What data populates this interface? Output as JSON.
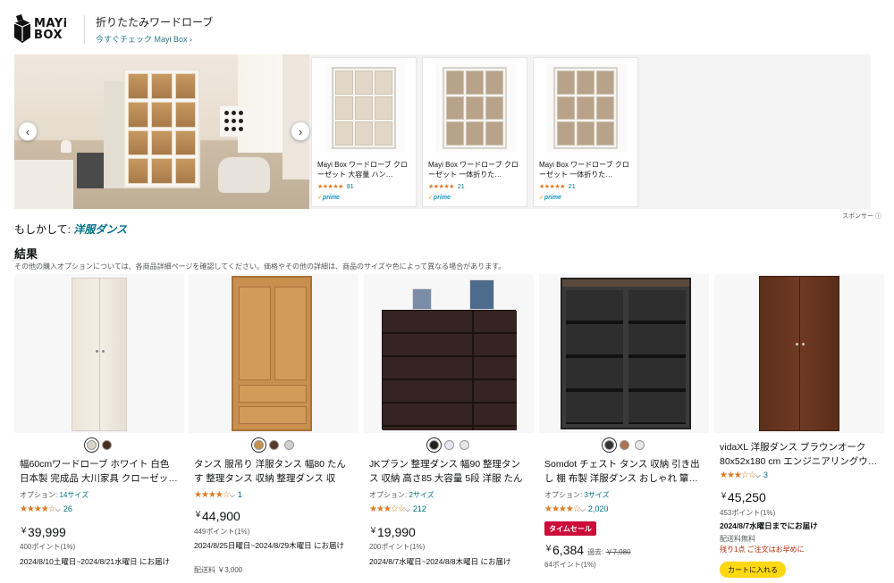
{
  "brand": {
    "logo_text_line1": "MAYi",
    "logo_text_line2": "BOX",
    "title": "折りたたみワードローブ",
    "link": "今すぐチェック Mayi Box",
    "link_arrow": "›"
  },
  "banner": {
    "prev_icon": "‹",
    "next_icon": "›",
    "cards": [
      {
        "title": "Mayi Box ワードローブ クローゼット 大容量 ハン…",
        "stars": "★★★★★",
        "count": "81",
        "prime": "prime"
      },
      {
        "title": "Mayi Box ワードローブ クローゼット 一体折りた…",
        "stars": "★★★★★",
        "count": "21",
        "prime": "prime"
      },
      {
        "title": "Mayi Box ワードローブ クローゼット 一体折りた…",
        "stars": "★★★★★",
        "count": "21",
        "prime": "prime"
      }
    ],
    "sponsored": "スポンサー ⓘ"
  },
  "did_you_mean": {
    "prefix": "もしかして:",
    "term": "洋服ダンス"
  },
  "results": {
    "heading": "結果",
    "note": "その他の購入オプションについては、各商品詳細ページを確認してください。価格やその他の詳細は、商品のサイズや色によって異なる場合があります。"
  },
  "products": [
    {
      "title": "幅60cmワードローブ ホワイト 白色 日本製 完成品 大川家具 クローゼッ…",
      "option_label": "オプション:",
      "option_value": "14サイズ",
      "stars": "★★★★☆",
      "rating_count": "26",
      "price_symbol": "￥",
      "price": "39,999",
      "points": "400ポイント(1%)",
      "delivery": "2024/8/10土曜日~2024/8/21水曜日 にお届け",
      "swatches": [
        "#d8d4c8",
        "#4a2c1e"
      ]
    },
    {
      "title": "タンス 服吊り 洋服タンス 幅80 たんす 整理タンス 収納 整理ダンス 収納…",
      "stars": "★★★★☆",
      "rating_count": "1",
      "price_symbol": "￥",
      "price": "44,900",
      "points": "449ポイント(1%)",
      "delivery": "2024/8/25日曜日~2024/8/29木曜日 にお届け",
      "shipping": "配送料 ￥3,000",
      "swatches": [
        "#c8924f",
        "#5a3a28",
        "#cfcfcf"
      ]
    },
    {
      "title": "JKプラン 整理ダンス 幅90 整理タンス 収納 高さ85 大容量 5段 洋服 たんす…",
      "option_label": "オプション:",
      "option_value": "2サイズ",
      "stars": "★★★☆☆",
      "rating_count": "212",
      "price_symbol": "￥",
      "price": "19,990",
      "points": "200ポイント(1%)",
      "delivery": "2024/8/7水曜日~2024/8/8木曜日 にお届け",
      "swatches": [
        "#222222",
        "#e8e6f4",
        "#e5e5e5"
      ]
    },
    {
      "title": "Somdot チェスト タンス 収納 引き出し 棚 布製 洋服ダンス おしゃれ 簞…",
      "option_label": "オプション:",
      "option_value": "3サイズ",
      "stars": "★★★★☆",
      "rating_count": "2,020",
      "deal": "タイムセール",
      "price_symbol": "￥",
      "price": "6,384",
      "price_note": "過去:",
      "prev_price": "￥7,980",
      "points": "64ポイント(1%)",
      "swatches": [
        "#333333",
        "#b0724e",
        "#e8e8e8"
      ]
    },
    {
      "title": "vidaXL 洋服ダンス ブラウンオーク 80x52x180 cm エンジニアリングウ…",
      "stars": "★★★☆☆",
      "rating_count": "3",
      "price_symbol": "￥",
      "price": "45,250",
      "points": "453ポイント(1%)",
      "delivery": "2024/8/7水曜日までにお届け",
      "shipping": "配送料無料",
      "stock": "残り1点 ご注文はお早めに",
      "cart": "カートに入れる"
    }
  ]
}
